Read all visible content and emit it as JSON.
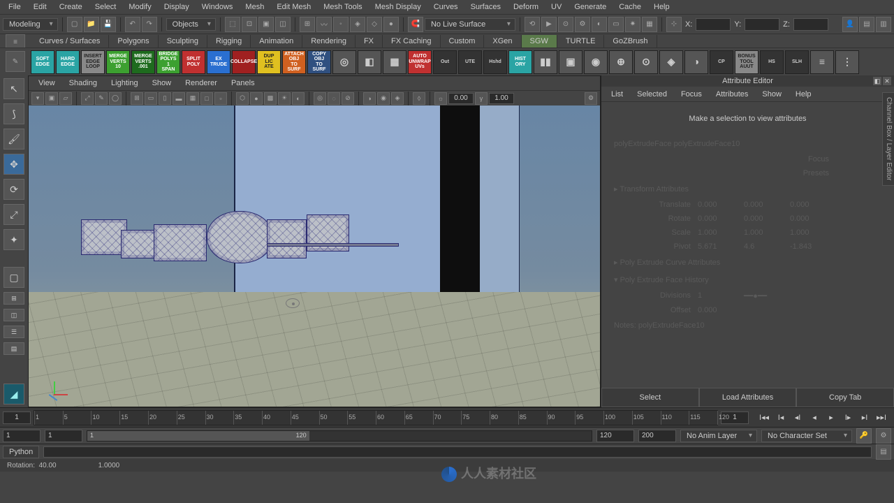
{
  "menu": [
    "File",
    "Edit",
    "Create",
    "Select",
    "Modify",
    "Display",
    "Windows",
    "Mesh",
    "Edit Mesh",
    "Mesh Tools",
    "Mesh Display",
    "Curves",
    "Surfaces",
    "Deform",
    "UV",
    "Generate",
    "Cache",
    "Help"
  ],
  "mode_dropdown": "Modeling",
  "objects_dropdown": "Objects",
  "live_surface": "No Live Surface",
  "coord": {
    "x_label": "X:",
    "y_label": "Y:",
    "z_label": "Z:",
    "x": "",
    "y": "",
    "z": ""
  },
  "tabs": [
    "Curves / Surfaces",
    "Polygons",
    "Sculpting",
    "Rigging",
    "Animation",
    "Rendering",
    "FX",
    "FX Caching",
    "Custom",
    "XGen",
    "SGW",
    "TURTLE",
    "GoZBrush"
  ],
  "active_tab": "SGW",
  "shelf_buttons": [
    {
      "t": "SOFT EDGE",
      "c": "teal"
    },
    {
      "t": "HARD EDGE",
      "c": "teal"
    },
    {
      "t": "INSERT EDGE LOOP",
      "c": "gray"
    },
    {
      "t": "MERGE VERTS 10",
      "c": "green"
    },
    {
      "t": "MERGE VERTS .001",
      "c": "dgreen"
    },
    {
      "t": "BRIDGE POLYS 1 SPAN",
      "c": "green"
    },
    {
      "t": "SPLIT POLY",
      "c": "red"
    },
    {
      "t": "EX TRUDE",
      "c": "blue"
    },
    {
      "t": "COLLAPSE",
      "c": "drk"
    },
    {
      "t": "DUP LIC ATE",
      "c": "yel"
    },
    {
      "t": "ATTACH OBJ TO SURF",
      "c": "org"
    },
    {
      "t": "COPY OBJ TO SURF",
      "c": "nvy"
    },
    {
      "t": "◎",
      "c": "icon"
    },
    {
      "t": "◧",
      "c": "icon"
    },
    {
      "t": "▦",
      "c": "icon"
    },
    {
      "t": "AUTO UNWRAP UVs",
      "c": "red"
    },
    {
      "t": "Out",
      "c": "w"
    },
    {
      "t": "UTE",
      "c": "w"
    },
    {
      "t": "Hshd",
      "c": "w"
    },
    {
      "t": "HIST ORY",
      "c": "teal"
    },
    {
      "t": "▮▮",
      "c": "icon"
    },
    {
      "t": "▣",
      "c": "icon"
    },
    {
      "t": "◉",
      "c": "icon"
    },
    {
      "t": "⊕",
      "c": "icon"
    },
    {
      "t": "⊙",
      "c": "icon"
    },
    {
      "t": "◈",
      "c": "icon"
    },
    {
      "t": "◑",
      "c": "icon"
    },
    {
      "t": "CP",
      "c": "w"
    },
    {
      "t": "BONUS TOOL AUUT",
      "c": "gray"
    },
    {
      "t": "HS",
      "c": "w"
    },
    {
      "t": "SLH",
      "c": "w"
    },
    {
      "t": "≡",
      "c": "icon"
    },
    {
      "t": "⋮",
      "c": "icon"
    }
  ],
  "vp_menu": [
    "View",
    "Shading",
    "Lighting",
    "Show",
    "Renderer",
    "Panels"
  ],
  "vp_nums": {
    "a": "0.00",
    "b": "1.00"
  },
  "attr": {
    "title": "Attribute Editor",
    "menu": [
      "List",
      "Selected",
      "Focus",
      "Attributes",
      "Show",
      "Help"
    ],
    "msg": "Make a selection to view attributes",
    "ghost_tabs": "polyExtrudeFace     polyExtrudeFace10",
    "focus": "Focus",
    "presets": "Presets",
    "sections": {
      "transform": "Transform Attributes",
      "translate": {
        "l": "Translate",
        "a": "0.000",
        "b": "0.000",
        "c": "0.000"
      },
      "rotate": {
        "l": "Rotate",
        "a": "0.000",
        "b": "0.000",
        "c": "0.000"
      },
      "scale": {
        "l": "Scale",
        "a": "1.000",
        "b": "1.000",
        "c": "1.000"
      },
      "pivot": {
        "l": "Pivot",
        "a": "5.671",
        "b": "4.6",
        "c": "-1.843"
      },
      "curve": "Poly Extrude Curve Attributes",
      "history": "Poly Extrude Face History",
      "divisions": {
        "l": "Divisions",
        "v": "1"
      },
      "offset": {
        "l": "Offset",
        "v": "0.000"
      },
      "notes": "Notes:  polyExtrudeFace10"
    },
    "btns": [
      "Select",
      "Load Attributes",
      "Copy Tab"
    ],
    "vtab": "Channel Box / Layer Editor"
  },
  "timeline": {
    "start_field": "1",
    "ticks": [
      1,
      5,
      10,
      15,
      20,
      25,
      30,
      35,
      40,
      45,
      50,
      55,
      60,
      65,
      70,
      75,
      80,
      85,
      90,
      95,
      100,
      105,
      110,
      115,
      120
    ],
    "cur": "1"
  },
  "range": {
    "a": "1",
    "b": "1",
    "c_in_slider_left": "1",
    "c_in_slider_right": "120",
    "d": "120",
    "e": "200",
    "anim_layer": "No Anim Layer",
    "char_set": "No Character Set"
  },
  "cmd_lang": "Python",
  "status": {
    "rot_label": "Rotation:",
    "rot": "40.00",
    "val2": "1.0000"
  },
  "watermark": "人人素材社区"
}
